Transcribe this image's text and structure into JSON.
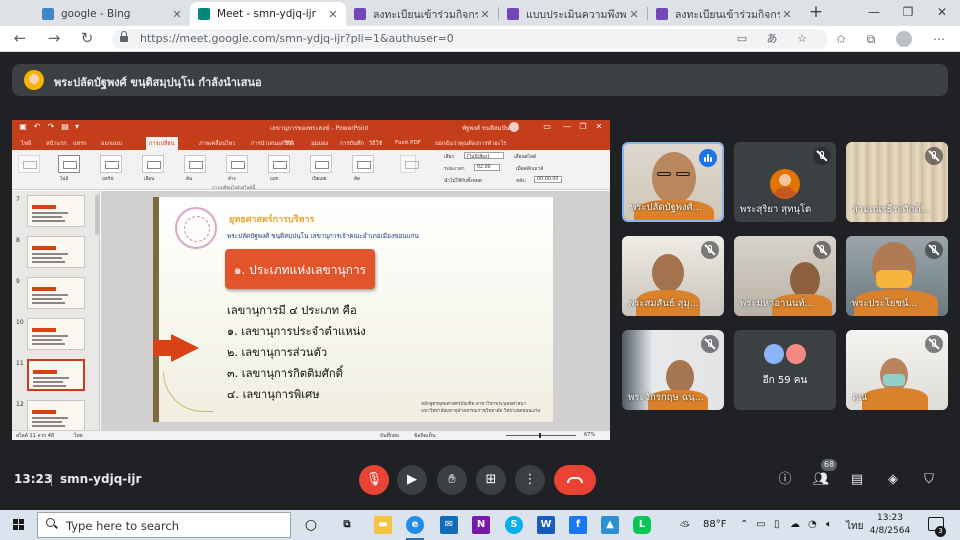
{
  "browser": {
    "tabs": [
      {
        "title": "google - Bing",
        "icon": "bing-icon",
        "color": "#3f87c9"
      },
      {
        "title": "Meet - smn-ydjq-ijr",
        "icon": "meet-icon",
        "color": "#00897b"
      },
      {
        "title": "ลงทะเบียนเข้าร่วมกิจกรรม #ลง",
        "icon": "forms-icon",
        "color": "#7248b9"
      },
      {
        "title": "แบบประเมินความพึงพอใจ กิจก",
        "icon": "forms-icon",
        "color": "#7248b9"
      },
      {
        "title": "ลงทะเบียนเข้าร่วมกิจกรรม พระ",
        "icon": "forms-icon",
        "color": "#7248b9"
      }
    ],
    "url": "https://meet.google.com/smn-ydjq-ijr?pli=1&authuser=0"
  },
  "meet": {
    "presenter_banner": "พระปลัดบัฐพงศ์ ขนฺติสมฺปนฺโน กำลังนำเสนอ",
    "time": "13:23",
    "meeting_code": "smn-ydjq-ijr",
    "participants_count": "68",
    "accent": "#8ab4f8",
    "end_call_color": "#ea4335",
    "tiles": [
      {
        "name": "พระปลัดบัฐพงศ์...",
        "speaking": true
      },
      {
        "name": "พระสุริยา สุทนุโต",
        "muted": true
      },
      {
        "name": "สามเณรธีระศักดิ์...",
        "muted": true
      },
      {
        "name": "พระสมสันธ์ สุมุ...",
        "muted": true
      },
      {
        "name": "พระมหาอานนท์...",
        "muted": true
      },
      {
        "name": "พระประโยชน์...",
        "muted": true
      },
      {
        "name": "พระจักรกฤษ ฉนฺ...",
        "muted": true
      },
      {
        "name": "อีก 59 คน"
      },
      {
        "name": "คุณ",
        "muted": true
      }
    ]
  },
  "powerpoint": {
    "title": "เลขานุการของพระสงฆ์ - PowerPoint",
    "user": "พัฐพงศ์ ขนติสมปัน",
    "brand_color": "#c43e1c",
    "ribbon_tabs": [
      "ไฟล์",
      "หน้าแรก",
      "แทรก",
      "ออกแบบ",
      "การเปลี่ยน",
      "ภาพเคลื่อนไหว",
      "การนำเสนอสไลด์",
      "รีวิว",
      "มุมมอง",
      "การบันทึก",
      "วิธีใช้",
      "Foxit PDF",
      "บอกฉันว่าคุณต้องการทำอะไร"
    ],
    "active_tab_index": 4,
    "transitions": [
      "ไม่มี",
      "มอร์ฟ",
      "เลือน",
      "ดัน",
      "ล้าง",
      "แยก",
      "เปิดเผย",
      "ตัด"
    ],
    "ribbon_group_label": "การเปลี่ยนไปยังสไลด์นี้",
    "ribbon_options": {
      "sound_label": "เสียง",
      "sound_value": "[ไม่มีเสียง]",
      "duration_label": "ระยะเวลา",
      "duration_value": "02.00",
      "apply_all": "นำไปใช้กับทั้งหมด",
      "advance_label": "เลื่อนสไลด์",
      "on_click": "เมื่อคลิกเมาส์",
      "after_label": "หลัง:",
      "after_value": "00:00.00"
    },
    "slide_numbers": [
      "7",
      "8",
      "9",
      "10",
      "11",
      "12"
    ],
    "active_slide_number": "11",
    "status_left": "สไลด์ 11 จาก 48",
    "status_lang": "ไทย",
    "status_notes": "บันทึกย่อ",
    "status_comments": "ข้อคิดเห็น",
    "zoom": "67%"
  },
  "slide": {
    "header": "ยุทธศาสตร์การบริหาร",
    "subtitle": "พระปลัดบัฐพงศ์ ขนฺติสมฺปนฺโน เลขานุการเจ้าคณะอำเภอเมืองขอนแก่น",
    "title": "๑. ประเภทแห่งเลขานุการ",
    "lines": [
      "เลขานุการมี ๔ ประเภท คือ",
      "๑. เลขานุการประจำตำแหน่ง",
      "๒. เลขานุการส่วนตัว",
      "๓. เลขานุการกิตติมศักดิ์",
      "๔. เลขานุการพิเศษ"
    ],
    "footer_1": "หลักสูตรพุทธศาสตรบัณฑิต สาขาวิชาพระพุทธศาสนา",
    "footer_2": "มหาวิทยาลัยมหาจุฬาลงกรณราชวิทยาลัย วิทยาเขตขอนแก่น",
    "accent": "#e0552b"
  },
  "taskbar": {
    "search_placeholder": "Type here to search",
    "weather": "88°F",
    "lang": "ไทย",
    "time": "13:23",
    "date": "4/8/2564",
    "notifications": "3"
  }
}
